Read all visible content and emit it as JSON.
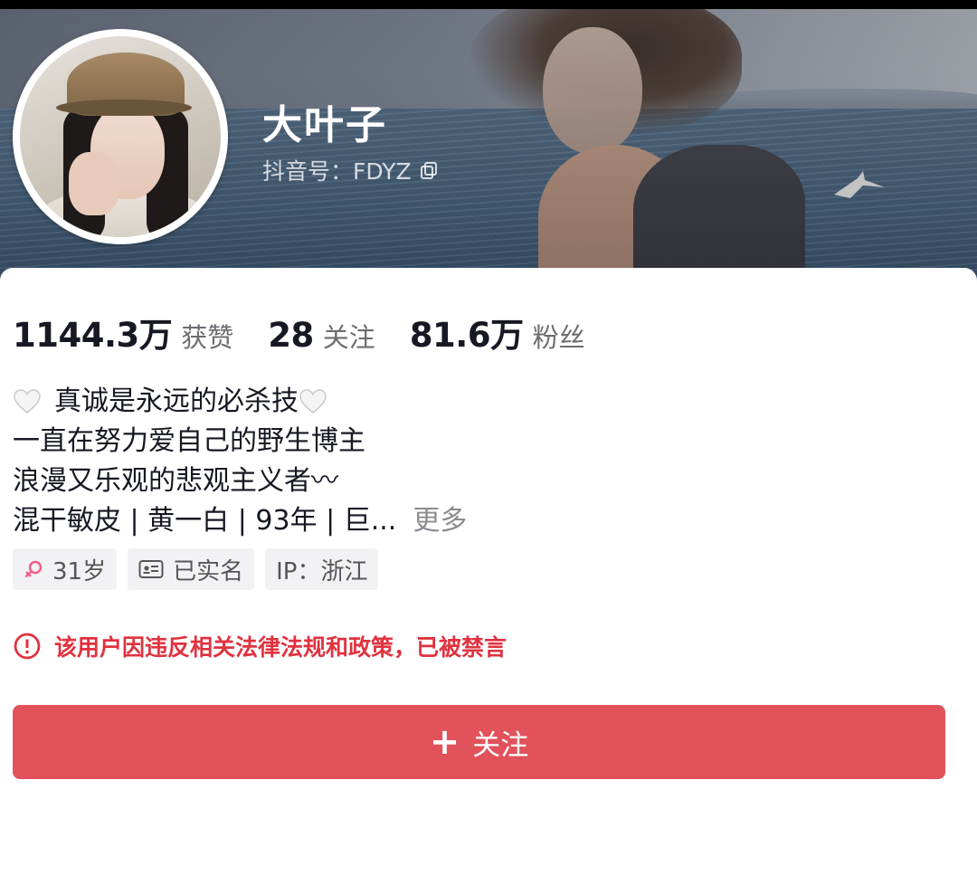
{
  "header": {
    "nickname": "大叶子",
    "account_id": "抖音号：FDYZ",
    "icons": {
      "copy": "copy-icon"
    }
  },
  "stats": [
    {
      "value": "1144.3万",
      "label": "获赞"
    },
    {
      "value": "28",
      "label": "关注"
    },
    {
      "value": "81.6万",
      "label": "粉丝"
    }
  ],
  "bio": {
    "line1": "真诚是永远的必杀技",
    "line2": "一直在努力爱自己的野生博主",
    "line3": "浪漫又乐观的悲观主义者〰",
    "line4": "混干敏皮 | 黄一白 | 93年 | 巨...",
    "more": "更多"
  },
  "tags": [
    {
      "icon": "female-icon",
      "label": "31岁"
    },
    {
      "icon": "id-card-icon",
      "label": "已实名"
    },
    {
      "icon": "",
      "label": "IP：浙江"
    }
  ],
  "notice": {
    "icon": "alert-circle-icon",
    "text": "该用户因违反相关法律法规和政策，已被禁言",
    "color": "#e0323f"
  },
  "follow_button": {
    "label": "关注",
    "color": "#e2525b"
  }
}
